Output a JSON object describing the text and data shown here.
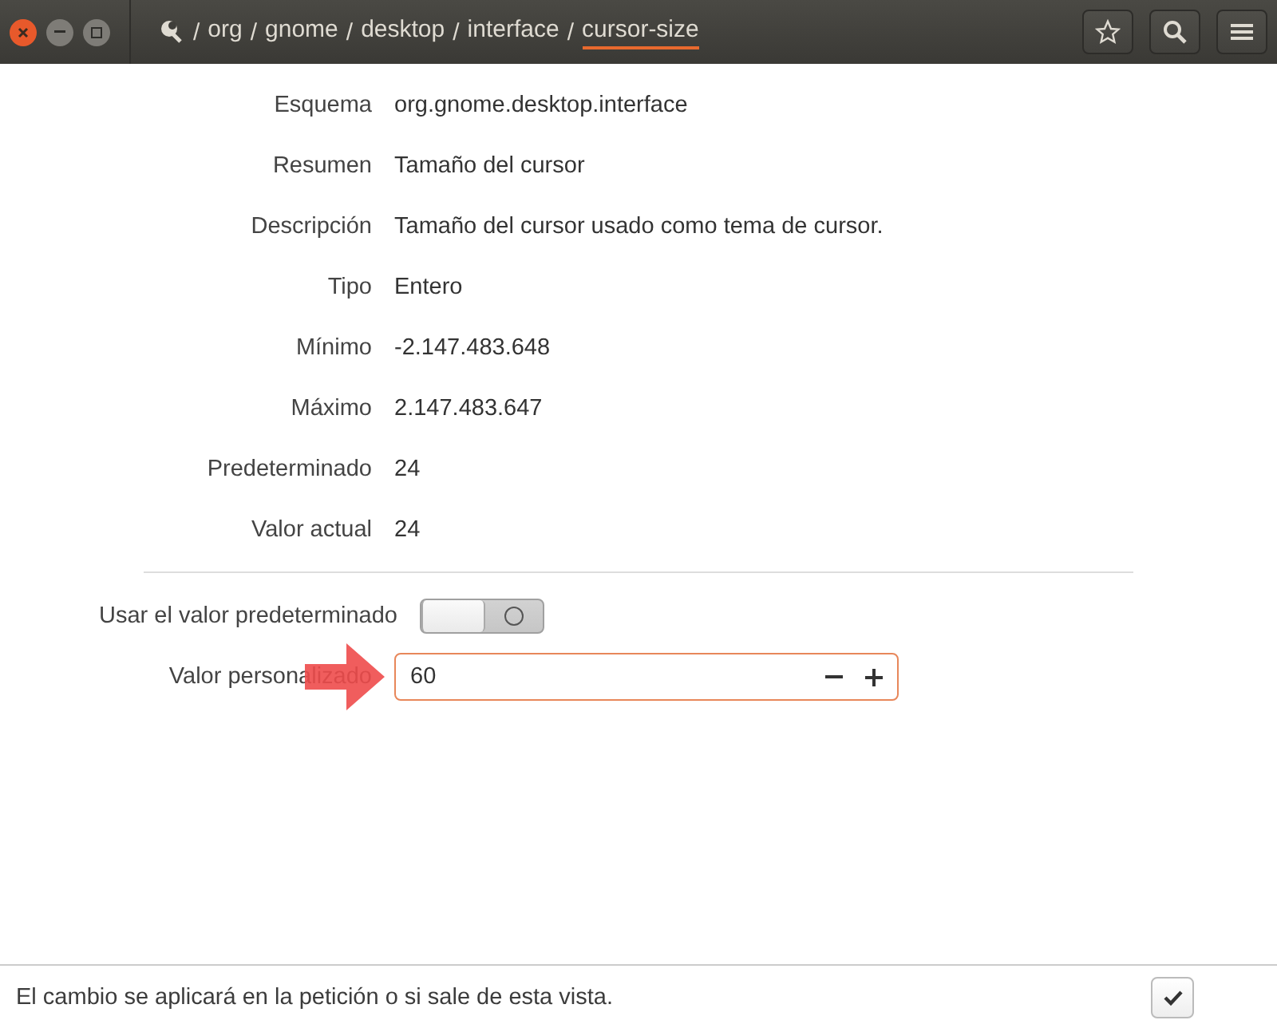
{
  "header": {
    "path": [
      {
        "label": "org",
        "selected": false
      },
      {
        "label": "gnome",
        "selected": false
      },
      {
        "label": "desktop",
        "selected": false
      },
      {
        "label": "interface",
        "selected": false
      },
      {
        "label": "cursor-size",
        "selected": true
      }
    ],
    "separator": "/"
  },
  "properties": [
    {
      "label": "Esquema",
      "value": "org.gnome.desktop.interface"
    },
    {
      "label": "Resumen",
      "value": "Tamaño del cursor"
    },
    {
      "label": "Descripción",
      "value": "Tamaño del cursor usado como tema de cursor."
    },
    {
      "label": "Tipo",
      "value": "Entero"
    },
    {
      "label": "Mínimo",
      "value": "-2.147.483.648"
    },
    {
      "label": "Máximo",
      "value": "2.147.483.647"
    },
    {
      "label": "Predeterminado",
      "value": "24"
    },
    {
      "label": "Valor actual",
      "value": "24"
    }
  ],
  "use_default": {
    "label": "Usar el valor predeterminado",
    "on": false
  },
  "custom_value": {
    "label": "Valor personalizado",
    "value": "60"
  },
  "footer": {
    "message": "El cambio se aplicará en la petición o si sale de esta vista."
  }
}
